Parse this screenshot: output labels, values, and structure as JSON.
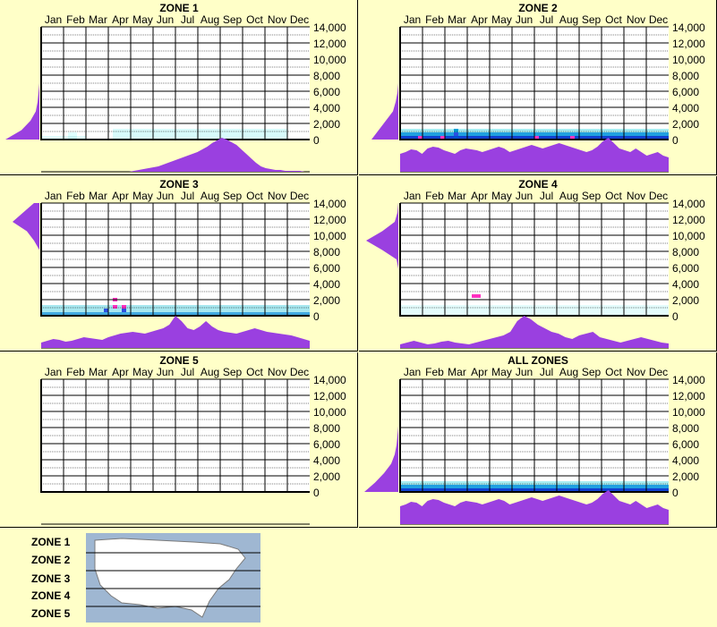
{
  "chart_data": [
    {
      "type": "heatmap",
      "title": "ZONE 1",
      "x_categories": [
        "Jan",
        "Feb",
        "Mar",
        "Apr",
        "May",
        "Jun",
        "Jul",
        "Aug",
        "Sep",
        "Oct",
        "Nov",
        "Dec"
      ],
      "y_ticks": [
        "14,000",
        "12,000",
        "10,000",
        "8,000",
        "6,000",
        "4,000",
        "2,000",
        "0"
      ],
      "ylim": [
        0,
        14000
      ],
      "hist_bottom": [
        0,
        0,
        0,
        0,
        0,
        0,
        0,
        0,
        0,
        0,
        0,
        0,
        0,
        0,
        0,
        0,
        0,
        0,
        0,
        1,
        2,
        3,
        4,
        5,
        6,
        8,
        10,
        12,
        14,
        16,
        18,
        20,
        22,
        25,
        28,
        32,
        35,
        38,
        36,
        33,
        30,
        25,
        20,
        15,
        10,
        6,
        4,
        3,
        2,
        2,
        1,
        1,
        1,
        1,
        0,
        0
      ],
      "hist_left": [
        38,
        20,
        10,
        4,
        2,
        1,
        0,
        0,
        0,
        0,
        0,
        0,
        0
      ],
      "cells": [
        [
          0,
          4,
          "#e0ffff"
        ],
        [
          0,
          3,
          "#e0ffff"
        ],
        [
          0,
          2,
          "#e0ffff"
        ],
        [
          0,
          1,
          "#e0ffff"
        ],
        [
          0,
          0,
          "#e0ffff"
        ],
        [
          0,
          5,
          "#e0ffff"
        ],
        [
          0,
          6,
          "#c8f4f4"
        ],
        [
          0,
          7,
          "#c8f4f4"
        ],
        [
          0,
          8,
          "#e0ffff"
        ],
        [
          0,
          9,
          "#e0ffff"
        ],
        [
          1,
          6,
          "#e0ffff"
        ],
        [
          1,
          7,
          "#e0ffff"
        ]
      ]
    },
    {
      "type": "heatmap",
      "title": "ZONE 2",
      "x_categories": [
        "Jan",
        "Feb",
        "Mar",
        "Apr",
        "May",
        "Jun",
        "Jul",
        "Aug",
        "Sep",
        "Oct",
        "Nov",
        "Dec"
      ],
      "y_ticks": [
        "14,000",
        "12,000",
        "10,000",
        "8,000",
        "6,000",
        "4,000",
        "2,000",
        "0"
      ],
      "ylim": [
        0,
        14000
      ],
      "hist_bottom": [
        20,
        22,
        25,
        24,
        20,
        26,
        28,
        27,
        24,
        22,
        20,
        24,
        26,
        25,
        24,
        22,
        24,
        26,
        28,
        26,
        22,
        24,
        26,
        28,
        30,
        28,
        26,
        28,
        30,
        32,
        30,
        28,
        26,
        24,
        22,
        24,
        28,
        34,
        38,
        32,
        26,
        24,
        22,
        26,
        22,
        18,
        20,
        22,
        18,
        16
      ],
      "hist_left": [
        30,
        22,
        14,
        6,
        3,
        1,
        0,
        0,
        0,
        0,
        0,
        0,
        0
      ],
      "cells": [
        [
          0,
          12,
          "#0050d0"
        ],
        [
          1,
          12,
          "#2b50e0"
        ],
        [
          2,
          12,
          "#00a0d8"
        ],
        [
          0,
          9,
          "#ff30c0"
        ],
        [
          0,
          4,
          "#ff30c0"
        ],
        [
          0,
          38,
          "#ff30c0"
        ],
        [
          0,
          30,
          "#ff30c0"
        ]
      ]
    },
    {
      "type": "heatmap",
      "title": "ZONE 3",
      "x_categories": [
        "Jan",
        "Feb",
        "Mar",
        "Apr",
        "May",
        "Jun",
        "Jul",
        "Aug",
        "Sep",
        "Oct",
        "Nov",
        "Dec"
      ],
      "y_ticks": [
        "14,000",
        "12,000",
        "10,000",
        "8,000",
        "6,000",
        "4,000",
        "2,000",
        "0"
      ],
      "ylim": [
        0,
        14000
      ],
      "hist_bottom": [
        6,
        8,
        10,
        9,
        7,
        8,
        10,
        12,
        11,
        10,
        9,
        12,
        14,
        16,
        17,
        18,
        17,
        16,
        18,
        20,
        22,
        26,
        36,
        30,
        22,
        20,
        24,
        30,
        24,
        20,
        18,
        17,
        16,
        18,
        20,
        22,
        20,
        18,
        17,
        16,
        15,
        14,
        12,
        10,
        8
      ],
      "hist_left": [
        0,
        0,
        0,
        0,
        0,
        0,
        0,
        0,
        6,
        14,
        30,
        18,
        6
      ],
      "cells": [
        [
          2,
          16,
          "#ff30c0"
        ],
        [
          2,
          18,
          "#ff30c0"
        ],
        [
          4,
          16,
          "#ff30c0"
        ],
        [
          1,
          14,
          "#2b50e0"
        ],
        [
          1,
          18,
          "#2b50e0"
        ]
      ]
    },
    {
      "type": "heatmap",
      "title": "ZONE 4",
      "x_categories": [
        "Jan",
        "Feb",
        "Mar",
        "Apr",
        "May",
        "Jun",
        "Jul",
        "Aug",
        "Sep",
        "Oct",
        "Nov",
        "Dec"
      ],
      "y_ticks": [
        "14,000",
        "12,000",
        "10,000",
        "8,000",
        "6,000",
        "4,000",
        "2,000",
        "0"
      ],
      "ylim": [
        0,
        14000
      ],
      "hist_bottom": [
        4,
        6,
        8,
        6,
        4,
        5,
        7,
        8,
        6,
        5,
        4,
        6,
        8,
        10,
        12,
        14,
        18,
        30,
        36,
        32,
        26,
        22,
        18,
        16,
        12,
        10,
        14,
        16,
        18,
        12,
        10,
        8,
        6,
        8,
        10,
        12,
        10,
        8,
        6,
        5
      ],
      "hist_left": [
        0,
        0,
        0,
        0,
        0,
        0,
        2,
        18,
        36,
        18,
        4,
        1,
        0
      ],
      "cells": [
        [
          5,
          16,
          "#ff30c0"
        ],
        [
          5,
          17,
          "#ff30c0"
        ]
      ]
    },
    {
      "type": "heatmap",
      "title": "ZONE 5",
      "x_categories": [
        "Jan",
        "Feb",
        "Mar",
        "Apr",
        "May",
        "Jun",
        "Jul",
        "Aug",
        "Sep",
        "Oct",
        "Nov",
        "Dec"
      ],
      "y_ticks": [
        "14,000",
        "12,000",
        "10,000",
        "8,000",
        "6,000",
        "4,000",
        "2,000",
        "0"
      ],
      "ylim": [
        0,
        14000
      ],
      "hist_bottom": [],
      "hist_left": [],
      "cells": []
    },
    {
      "type": "heatmap",
      "title": "ALL ZONES",
      "x_categories": [
        "Jan",
        "Feb",
        "Mar",
        "Apr",
        "May",
        "Jun",
        "Jul",
        "Aug",
        "Sep",
        "Oct",
        "Nov",
        "Dec"
      ],
      "y_ticks": [
        "14,000",
        "12,000",
        "10,000",
        "8,000",
        "6,000",
        "4,000",
        "2,000",
        "0"
      ],
      "ylim": [
        0,
        14000
      ],
      "hist_bottom": [
        20,
        22,
        25,
        24,
        20,
        26,
        28,
        27,
        24,
        22,
        20,
        24,
        26,
        25,
        24,
        22,
        24,
        26,
        28,
        26,
        22,
        24,
        26,
        28,
        30,
        28,
        26,
        28,
        30,
        32,
        30,
        28,
        26,
        24,
        22,
        24,
        28,
        34,
        38,
        32,
        26,
        24,
        22,
        26,
        22,
        18,
        20,
        22,
        18,
        16
      ],
      "hist_left": [
        38,
        26,
        16,
        8,
        4,
        2,
        1,
        0,
        0,
        0,
        0,
        0,
        0
      ],
      "cells": []
    }
  ],
  "legend": {
    "zones": [
      "ZONE 1",
      "ZONE 2",
      "ZONE 3",
      "ZONE 4",
      "ZONE 5"
    ]
  },
  "colors": {
    "background": "#ffffc8",
    "histogram": "#9a40e0",
    "grid": "#000000"
  }
}
